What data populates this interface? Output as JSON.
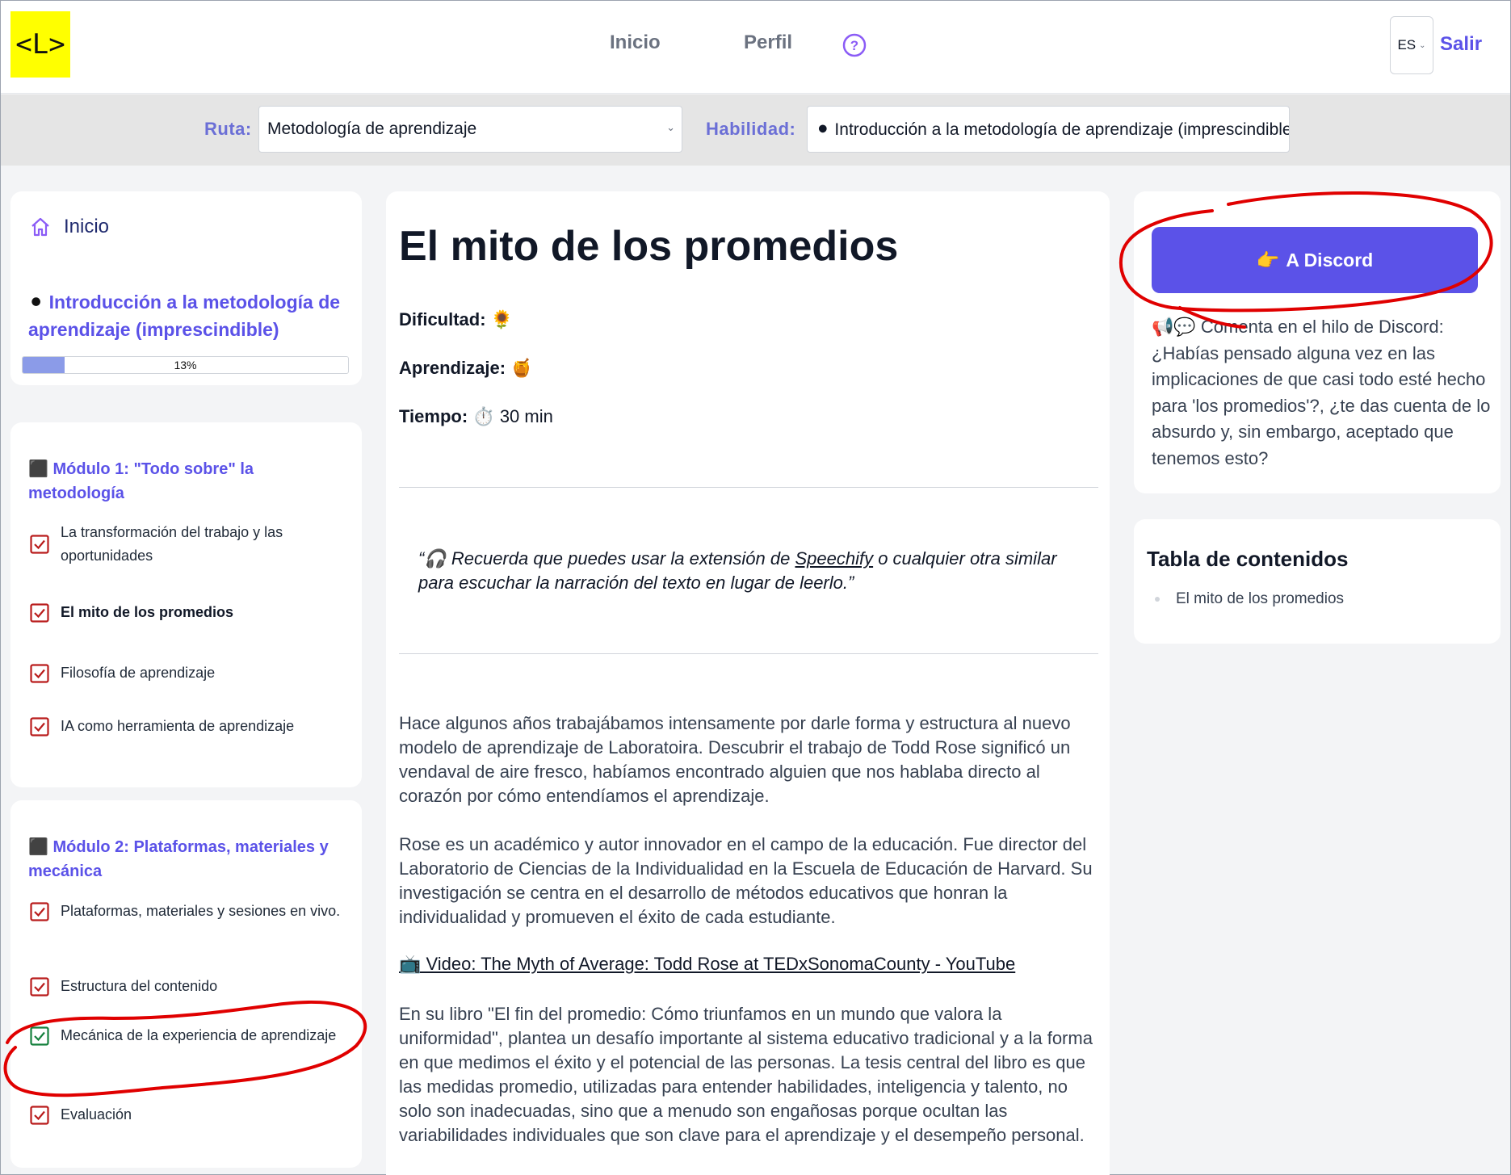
{
  "header": {
    "logo": "<L>",
    "nav": [
      "Inicio",
      "Perfil"
    ],
    "language": "ES",
    "logout": "Salir"
  },
  "selectors": {
    "route_label": "Ruta:",
    "route_value": "Metodología de aprendizaje",
    "skill_label": "Habilidad:",
    "skill_value": "⚫ Introducción a la metodología de aprendizaje (imprescindible)"
  },
  "sidebar": {
    "home": "Inicio",
    "skill_dot": "⚫",
    "skill_title": "Introducción a la metodología de aprendizaje (imprescindible)",
    "progress": 0.13,
    "progress_label": "13%",
    "modules": [
      {
        "marker": "⬛",
        "title": "Módulo 1: \"Todo sobre\" la metodología",
        "lessons": [
          {
            "label": "La transformación del trabajo y las oportunidades",
            "done": true
          },
          {
            "label": "El mito de los promedios",
            "done": true,
            "active": true
          },
          {
            "label": "Filosofía de aprendizaje",
            "done": true
          },
          {
            "label": "IA como herramienta de aprendizaje",
            "done": true
          }
        ]
      },
      {
        "marker": "⬛",
        "title": "Módulo 2: Plataformas, materiales y mecánica",
        "lessons": [
          {
            "label": "Plataformas, materiales y sesiones en vivo.",
            "done": true
          },
          {
            "label": "Estructura del contenido",
            "done": true
          },
          {
            "label": "Mecánica de la experiencia de aprendizaje",
            "done": true,
            "highlight": true
          },
          {
            "label": "Evaluación",
            "done": true
          }
        ]
      }
    ]
  },
  "main": {
    "title": "El mito de los promedios",
    "difficulty_label": "Dificultad:",
    "difficulty_icon": "🌻",
    "learning_label": "Aprendizaje:",
    "learning_icon": "🍯",
    "time_label": "Tiempo:",
    "time_icon": "⏱️",
    "time_value": "30 min",
    "quote_open": "“🎧 Recuerda que puedes usar la extensión de ",
    "quote_link": "Speechify",
    "quote_close": " o cualquier otra similar para escuchar la narración del texto en lugar de leerlo.”",
    "p1": "Hace algunos años trabajábamos intensamente por darle forma y estructura al nuevo modelo de aprendizaje de Laboratoira. Descubrir el trabajo de Todd Rose significó un vendaval de aire fresco, habíamos encontrado alguien que nos hablaba directo al corazón por cómo entendíamos el aprendizaje.",
    "p2": "Rose es un académico y autor innovador en el campo de la educación. Fue director del Laboratorio de Ciencias de la Individualidad en la Escuela de Educación de Harvard. Su investigación se centra en el desarrollo de métodos educativos que honran la individualidad y promueven el éxito de cada estudiante.",
    "video_link": "📺 Video: The Myth of Average: Todd Rose at TEDxSonomaCounty - YouTube",
    "p3": "En su libro \"El fin del promedio: Cómo triunfamos en un mundo que valora la uniformidad\", plantea un desafío importante al sistema educativo tradicional y a la forma en que medimos el éxito y el potencial de las personas. La tesis central del libro es que las medidas promedio, utilizadas para entender habilidades, inteligencia y talento, no solo son inadecuadas, sino que a menudo son engañosas porque ocultan las variabilidades individuales que son clave para el aprendizaje y el desempeño personal."
  },
  "right": {
    "discord_icon": "👉",
    "discord_label": "A Discord",
    "comment": "📢💬 Comenta en el hilo de Discord: ¿Habías pensado alguna vez en las implicaciones de que casi todo esté hecho para 'los promedios'?, ¿te das cuenta de lo absurdo y, sin embargo, aceptado que tenemos esto?",
    "toc_title": "Tabla de contenidos",
    "toc_items": [
      "El mito de los promedios"
    ]
  },
  "colors": {
    "accent": "#5b52e8",
    "logo_bg": "#ffff00",
    "check_red": "#b91c1c",
    "check_green": "#15803d",
    "annotation": "#e00000"
  }
}
